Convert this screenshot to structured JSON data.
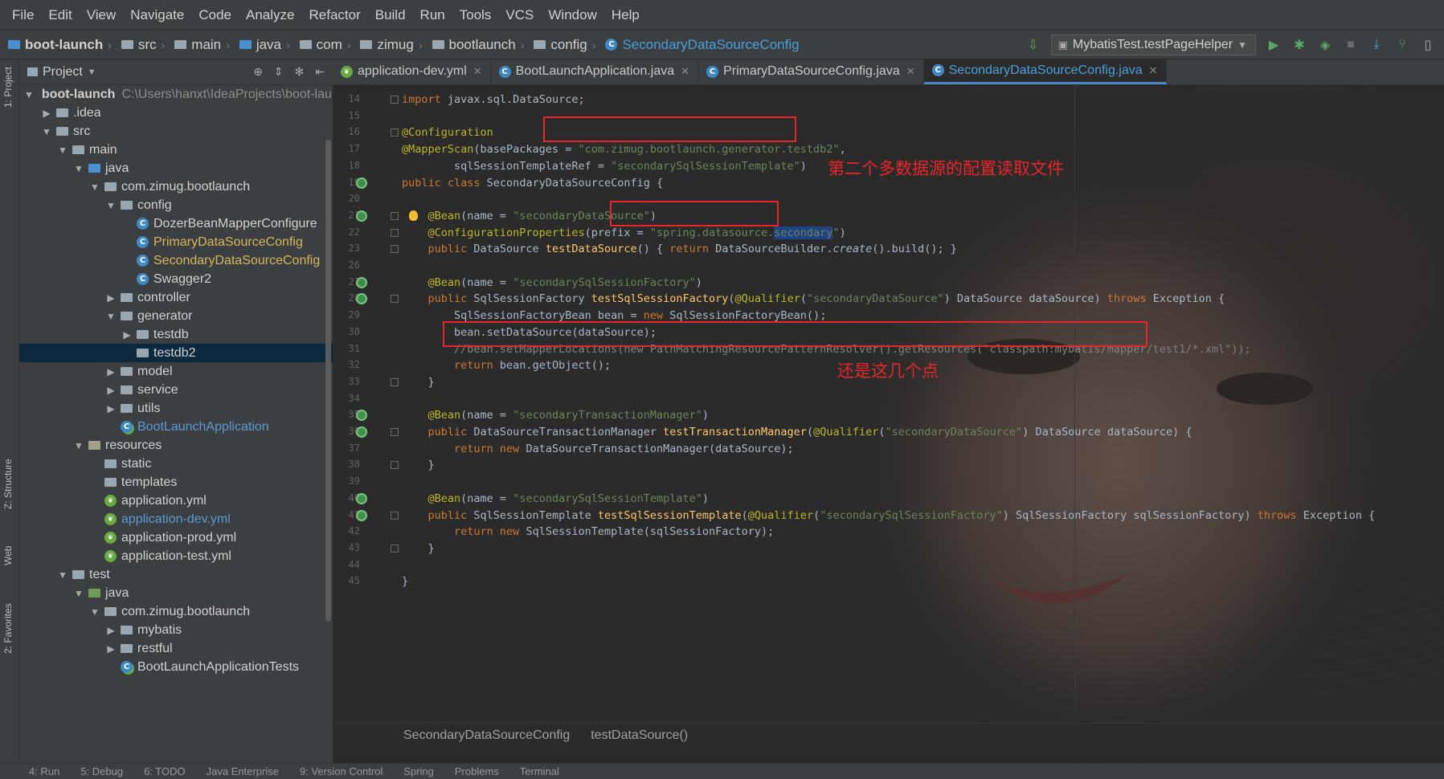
{
  "menu": [
    "File",
    "Edit",
    "View",
    "Navigate",
    "Code",
    "Analyze",
    "Refactor",
    "Build",
    "Run",
    "Tools",
    "VCS",
    "Window",
    "Help"
  ],
  "breadcrumbs": [
    "boot-launch",
    "src",
    "main",
    "java",
    "com",
    "zimug",
    "bootlaunch",
    "config",
    "SecondaryDataSourceConfig"
  ],
  "run_config": "MybatisTest.testPageHelper",
  "left_strip": [
    "1: Project",
    "Z: Structure",
    "Web",
    "2: Favorites"
  ],
  "project_panel": {
    "title": "Project",
    "tree": [
      {
        "label": "boot-launch",
        "path": "C:\\Users\\hanxt\\IdeaProjects\\boot-launch",
        "depth": 0,
        "arrow": "down",
        "icon": "module"
      },
      {
        "label": ".idea",
        "depth": 1,
        "arrow": "right",
        "icon": "folder"
      },
      {
        "label": "src",
        "depth": 1,
        "arrow": "down",
        "icon": "folder"
      },
      {
        "label": "main",
        "depth": 2,
        "arrow": "down",
        "icon": "folder"
      },
      {
        "label": "java",
        "depth": 3,
        "arrow": "down",
        "icon": "folder-blue"
      },
      {
        "label": "com.zimug.bootlaunch",
        "depth": 4,
        "arrow": "down",
        "icon": "package"
      },
      {
        "label": "config",
        "depth": 5,
        "arrow": "down",
        "icon": "package"
      },
      {
        "label": "DozerBeanMapperConfigure",
        "depth": 6,
        "icon": "class"
      },
      {
        "label": "PrimaryDataSourceConfig",
        "depth": 6,
        "icon": "class",
        "style": "yellow"
      },
      {
        "label": "SecondaryDataSourceConfig",
        "depth": 6,
        "icon": "class",
        "style": "yellow"
      },
      {
        "label": "Swagger2",
        "depth": 6,
        "icon": "class"
      },
      {
        "label": "controller",
        "depth": 5,
        "arrow": "right",
        "icon": "package"
      },
      {
        "label": "generator",
        "depth": 5,
        "arrow": "down",
        "icon": "package"
      },
      {
        "label": "testdb",
        "depth": 6,
        "arrow": "right",
        "icon": "package"
      },
      {
        "label": "testdb2",
        "depth": 6,
        "icon": "package",
        "selected": true
      },
      {
        "label": "model",
        "depth": 5,
        "arrow": "right",
        "icon": "package"
      },
      {
        "label": "service",
        "depth": 5,
        "arrow": "right",
        "icon": "package"
      },
      {
        "label": "utils",
        "depth": 5,
        "arrow": "right",
        "icon": "package"
      },
      {
        "label": "BootLaunchApplication",
        "depth": 5,
        "icon": "spring-class",
        "style": "blue"
      },
      {
        "label": "resources",
        "depth": 3,
        "arrow": "down",
        "icon": "folder-res"
      },
      {
        "label": "static",
        "depth": 4,
        "icon": "folder"
      },
      {
        "label": "templates",
        "depth": 4,
        "icon": "folder"
      },
      {
        "label": "application.yml",
        "depth": 4,
        "icon": "yml"
      },
      {
        "label": "application-dev.yml",
        "depth": 4,
        "icon": "yml",
        "style": "blue"
      },
      {
        "label": "application-prod.yml",
        "depth": 4,
        "icon": "yml"
      },
      {
        "label": "application-test.yml",
        "depth": 4,
        "icon": "yml"
      },
      {
        "label": "test",
        "depth": 2,
        "arrow": "down",
        "icon": "folder"
      },
      {
        "label": "java",
        "depth": 3,
        "arrow": "down",
        "icon": "folder-green"
      },
      {
        "label": "com.zimug.bootlaunch",
        "depth": 4,
        "arrow": "down",
        "icon": "package"
      },
      {
        "label": "mybatis",
        "depth": 5,
        "arrow": "right",
        "icon": "package"
      },
      {
        "label": "restful",
        "depth": 5,
        "arrow": "right",
        "icon": "package"
      },
      {
        "label": "BootLaunchApplicationTests",
        "depth": 5,
        "icon": "spring-class"
      }
    ]
  },
  "tabs": [
    {
      "label": "application-dev.yml",
      "icon": "yml"
    },
    {
      "label": "BootLaunchApplication.java",
      "icon": "class"
    },
    {
      "label": "PrimaryDataSourceConfig.java",
      "icon": "class"
    },
    {
      "label": "SecondaryDataSourceConfig.java",
      "icon": "class",
      "active": true
    }
  ],
  "line_numbers": [
    "14",
    "15",
    "16",
    "17",
    "18",
    "19",
    "20",
    "21",
    "22",
    "23",
    "26",
    "27",
    "28",
    "29",
    "30",
    "31",
    "32",
    "33",
    "34",
    "35",
    "36",
    "37",
    "38",
    "39",
    "40",
    "41",
    "42",
    "43",
    "44",
    "45"
  ],
  "code": {
    "l14": [
      "import",
      " javax.sql.DataSource;"
    ],
    "l16": "@Configuration",
    "l17": [
      "@MapperScan",
      "(basePackages = ",
      "\"com.zimug.bootlaunch.generator.testdb2\"",
      ","
    ],
    "l18": [
      "        sqlSessionTemplateRef = ",
      "\"secondarySqlSessionTemplate\"",
      ")"
    ],
    "l19": [
      "public class",
      " SecondaryDataSourceConfig {"
    ],
    "l21": [
      "    @Bean",
      "(name = ",
      "\"secondaryDataSource\"",
      ")"
    ],
    "l22": [
      "    @ConfigurationProperties",
      "(prefix = ",
      "\"spring.datasource.",
      "secondary",
      "\"",
      ")"
    ],
    "l23": [
      "    public",
      " DataSource ",
      "testDataSource",
      "() { ",
      "return",
      " DataSourceBuilder.",
      "create",
      "().build(); }"
    ],
    "l27": [
      "    @Bean",
      "(name = ",
      "\"secondarySqlSessionFactory\"",
      ")"
    ],
    "l28": [
      "    public",
      " SqlSessionFactory ",
      "testSqlSessionFactory",
      "(",
      "@Qualifier",
      "(",
      "\"secondaryDataSource\"",
      ") DataSource dataSource) ",
      "throws",
      " Exception {"
    ],
    "l29": [
      "        SqlSessionFactoryBean bean = ",
      "new",
      " SqlSessionFactoryBean();"
    ],
    "l30": "        bean.setDataSource(dataSource);",
    "l31": "        //bean.setMapperLocations(new PathMatchingResourcePatternResolver().getResources(\"classpath:mybatis/mapper/test1/*.xml\"));",
    "l32": [
      "        return",
      " bean.getObject();"
    ],
    "l33": "    }",
    "l35": [
      "    @Bean",
      "(name = ",
      "\"secondaryTransactionManager\"",
      ")"
    ],
    "l36": [
      "    public",
      " DataSourceTransactionManager ",
      "testTransactionManager",
      "(",
      "@Qualifier",
      "(",
      "\"secondaryDataSource\"",
      ") DataSource dataSource) {"
    ],
    "l37": [
      "        return new",
      " DataSourceTransactionManager(dataSource);"
    ],
    "l38": "    }",
    "l40": [
      "    @Bean",
      "(name = ",
      "\"secondarySqlSessionTemplate\"",
      ")"
    ],
    "l41": [
      "    public",
      " SqlSessionTemplate ",
      "testSqlSessionTemplate",
      "(",
      "@Qualifier",
      "(",
      "\"secondarySqlSessionFactory\"",
      ") SqlSessionFactory sqlSessionFactory) ",
      "throws",
      " Exception",
      " {"
    ],
    "l42": [
      "        return new",
      " SqlSessionTemplate(sqlSessionFactory);"
    ],
    "l43": "    }",
    "l45": "}"
  },
  "annotations": {
    "a1": "第二个多数据源的配置读取文件",
    "a2": "还是这几个点"
  },
  "editor_breadcrumb": [
    "SecondaryDataSourceConfig",
    "testDataSource()"
  ],
  "bottom_tools": [
    "4: Run",
    "5: Debug",
    "6: TODO",
    "Java Enterprise",
    "9: Version Control",
    "Spring",
    "Problems",
    "Terminal"
  ],
  "colors": {
    "accent": "#4a9fdc",
    "annotation_red": "#e8262a",
    "keyword": "#cc7832",
    "string": "#6a8759",
    "annotation": "#bbb529"
  }
}
